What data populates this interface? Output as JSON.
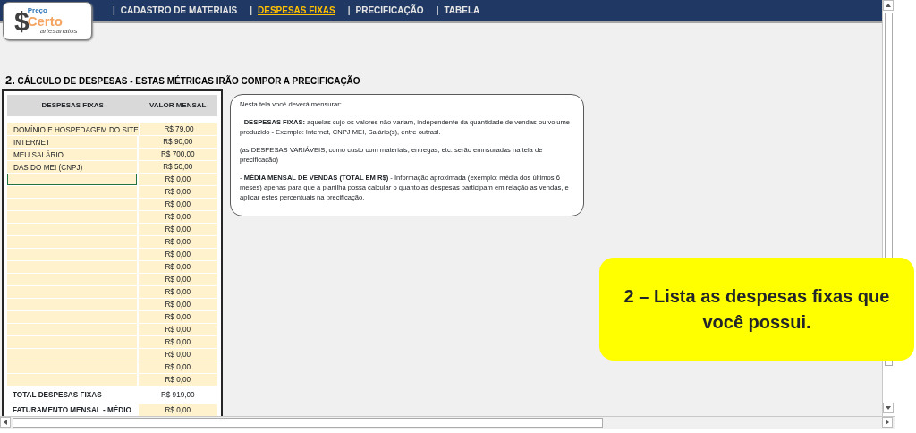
{
  "logo": {
    "symbol": "$",
    "top": "Preço",
    "main": "Certo",
    "sub": "artesanatos"
  },
  "nav": [
    {
      "separator": "|",
      "label": "CADASTRO DE MATERIAIS",
      "selected": false
    },
    {
      "separator": "|",
      "label": "DESPESAS FIXAS",
      "selected": true
    },
    {
      "separator": "|",
      "label": "PRECIFICAÇÃO",
      "selected": false
    },
    {
      "separator": "|",
      "label": "TABELA",
      "selected": false
    }
  ],
  "section": {
    "number": "2.",
    "title": "CÁLCULO DE DESPESAS - ESTAS MÉTRICAS IRÃO COMPOR A PRECIFICAÇÃO"
  },
  "table": {
    "columns": [
      "DESPESAS FIXAS",
      "VALOR MENSAL"
    ],
    "rows": [
      {
        "name": "DOMÍNIO E HOSPEDAGEM DO SITE",
        "value": "R$ 79,00",
        "selected": false
      },
      {
        "name": "INTERNET",
        "value": "R$ 90,00",
        "selected": false
      },
      {
        "name": "MEU SALÁRIO",
        "value": "R$ 700,00",
        "selected": false
      },
      {
        "name": "DAS DO MEI (CNPJ)",
        "value": "R$ 50,00",
        "selected": false
      },
      {
        "value": "R$ 0,00",
        "selected": true
      },
      {
        "value": "R$ 0,00",
        "selected": false
      },
      {
        "value": "R$ 0,00",
        "selected": false
      },
      {
        "value": "R$ 0,00",
        "selected": false
      },
      {
        "value": "R$ 0,00",
        "selected": false
      },
      {
        "value": "R$ 0,00",
        "selected": false
      },
      {
        "value": "R$ 0,00",
        "selected": false
      },
      {
        "value": "R$ 0,00",
        "selected": false
      },
      {
        "value": "R$ 0,00",
        "selected": false
      },
      {
        "value": "R$ 0,00",
        "selected": false
      },
      {
        "value": "R$ 0,00",
        "selected": false
      },
      {
        "value": "R$ 0,00",
        "selected": false
      },
      {
        "value": "R$ 0,00",
        "selected": false
      },
      {
        "value": "R$ 0,00",
        "selected": false
      },
      {
        "value": "R$ 0,00",
        "selected": false
      },
      {
        "value": "R$ 0,00",
        "selected": false
      },
      {
        "value": "R$ 0,00",
        "selected": false
      }
    ],
    "totals": [
      {
        "label": "TOTAL DESPESAS FIXAS",
        "value": "R$ 919,00",
        "kind": "computed"
      },
      {
        "label": "FATURAMENTO MENSAL - MÉDIO",
        "value": "R$ 0,00",
        "kind": "input"
      }
    ]
  },
  "info": [
    "Nesta tela você deverá mensurar:",
    "- **DESPESAS FIXAS:** aquelas cujo os valores não variam, independente da quantidade de vendas ou volume produzido - Exemplo: Internet, CNPJ MEI, Salário(s), entre outrasl.",
    "(as DESPESAS VARIÁVEIS, como custo com materiais, entregas, etc. serão emnsuradas na tela de precificação)",
    "- **MÉDIA MENSAL DE VENDAS (TOTAL EM R$)** - Informação aproximada (exemplo: média dos últimos 6 meses) apenas para que a planilha possa calcular o quanto as despesas participam em relação as vendas, e aplicar estes percentuais na precificação."
  ],
  "callout": "2 – Lista as despesas fixas que você possui."
}
